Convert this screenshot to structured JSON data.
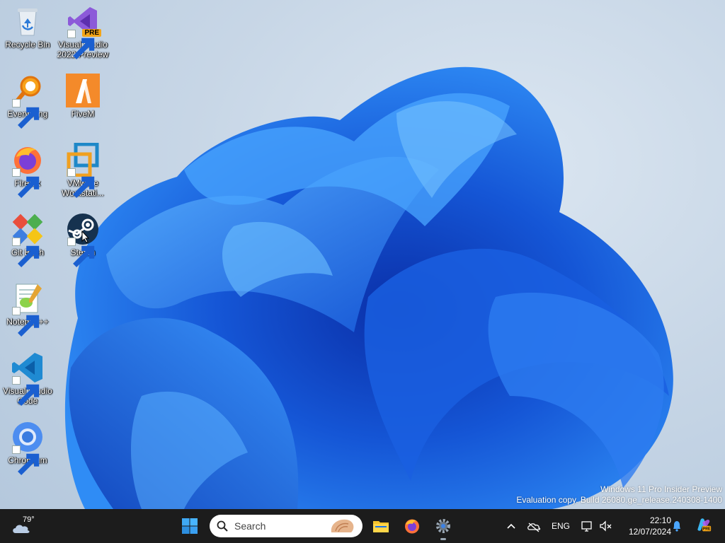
{
  "desktop": {
    "icons": [
      {
        "label": "Recycle Bin",
        "icon": "recycle-bin-icon"
      },
      {
        "label": "Visual Studio\n2022 Preview",
        "icon": "visual-studio-icon",
        "badge": "PRE"
      },
      {
        "label": "Everything",
        "icon": "everything-icon"
      },
      {
        "label": "FiveM",
        "icon": "fivem-icon"
      },
      {
        "label": "Firefox",
        "icon": "firefox-icon"
      },
      {
        "label": "VMware\nWorkstati...",
        "icon": "vmware-icon"
      },
      {
        "label": "Git Bash",
        "icon": "git-bash-icon"
      },
      {
        "label": "Steam",
        "icon": "steam-icon"
      },
      {
        "label": "Notepad++",
        "icon": "notepadpp-icon"
      },
      {
        "label": "Visual Studio\nCode",
        "icon": "vscode-icon"
      },
      {
        "label": "Chromium",
        "icon": "chromium-icon"
      }
    ],
    "watermark": {
      "line1": "Windows 11 Pro Insider Preview",
      "line2": "Evaluation copy. Build 26080.ge_release.240308-1400"
    }
  },
  "taskbar": {
    "weather": {
      "temp": "79°",
      "icon": "cloudy-weather-icon"
    },
    "start_icon": "windows-start-icon",
    "search": {
      "placeholder": "Search"
    },
    "apps": [
      {
        "name": "File Explorer",
        "icon": "file-explorer-icon"
      },
      {
        "name": "Firefox",
        "icon": "firefox-icon"
      },
      {
        "name": "Settings",
        "icon": "settings-gear-icon"
      }
    ],
    "tray": {
      "language": "ENG",
      "time": "22:10",
      "date": "12/07/2024"
    }
  },
  "colors": {
    "taskbar_bg": "#1c1c1c",
    "bloom_blue": "#1f6fe8",
    "wallpaper": "#c7d6e6"
  }
}
